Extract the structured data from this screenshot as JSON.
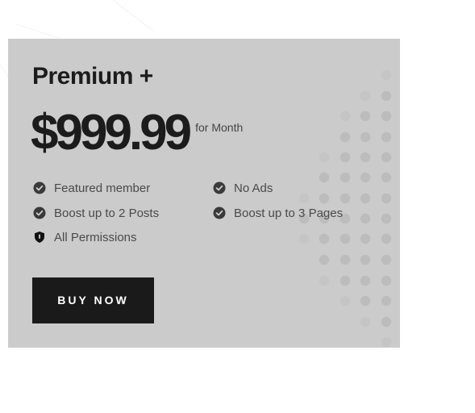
{
  "plan": {
    "name": "Premium +",
    "price": "$999.99",
    "period": "for Month"
  },
  "features": [
    {
      "label": "Featured member",
      "icon": "check-circle-icon"
    },
    {
      "label": "No Ads",
      "icon": "check-circle-icon"
    },
    {
      "label": "Boost up to 2 Posts",
      "icon": "check-circle-icon"
    },
    {
      "label": "Boost up to 3 Pages",
      "icon": "check-circle-icon"
    },
    {
      "label": "All Permissions",
      "icon": "shield-icon"
    }
  ],
  "cta": {
    "label": "BUY NOW"
  },
  "colors": {
    "card_background": "#cbcbcb",
    "button_background": "#1a1a1a",
    "text_dark": "#1c1c1c",
    "icon_dark": "#3a3a3a"
  }
}
